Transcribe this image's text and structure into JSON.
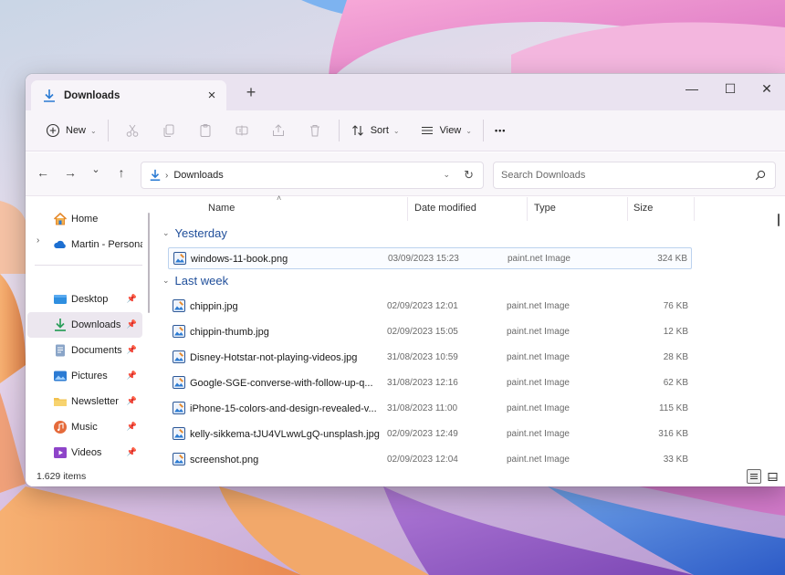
{
  "window": {
    "tab_title": "Downloads",
    "tab_close": "×",
    "new_tab": "+",
    "minimize": "—",
    "maximize": "☐",
    "close": "✕"
  },
  "toolbar": {
    "new_label": "New",
    "sort_label": "Sort",
    "view_label": "View",
    "more_label": "•••",
    "icons": [
      "cut-icon",
      "copy-icon",
      "paste-icon",
      "rename-icon",
      "share-icon",
      "delete-icon"
    ]
  },
  "address": {
    "back": "←",
    "forward": "→",
    "recent": "⌄",
    "up": "↑",
    "separator": "›",
    "crumb": "Downloads",
    "dropdown": "⌄",
    "refresh": "↻"
  },
  "search": {
    "placeholder": "Search Downloads"
  },
  "sidebar": {
    "expand_chevron": "›",
    "items": [
      {
        "label": "Home",
        "icon": "home-icon",
        "pinned": false
      },
      {
        "label": "Martin - Personal",
        "icon": "onedrive-icon",
        "pinned": false
      },
      {
        "label": "Desktop",
        "icon": "desktop-icon",
        "pinned": true
      },
      {
        "label": "Downloads",
        "icon": "download-icon",
        "pinned": true,
        "active": true
      },
      {
        "label": "Documents",
        "icon": "documents-icon",
        "pinned": true
      },
      {
        "label": "Pictures",
        "icon": "pictures-icon",
        "pinned": true
      },
      {
        "label": "Newsletter",
        "icon": "folder-icon",
        "pinned": true
      },
      {
        "label": "Music",
        "icon": "music-icon",
        "pinned": true
      },
      {
        "label": "Videos",
        "icon": "videos-icon",
        "pinned": true
      }
    ]
  },
  "columns": {
    "name": "Name",
    "date": "Date modified",
    "type": "Type",
    "size": "Size"
  },
  "groups": [
    {
      "label": "Yesterday",
      "files": [
        {
          "name": "windows-11-book.png",
          "date": "03/09/2023 15:23",
          "type": "paint.net Image",
          "size": "324 KB",
          "selected": true
        }
      ]
    },
    {
      "label": "Last week",
      "files": [
        {
          "name": "chippin.jpg",
          "date": "02/09/2023 12:01",
          "type": "paint.net Image",
          "size": "76 KB"
        },
        {
          "name": "chippin-thumb.jpg",
          "date": "02/09/2023 15:05",
          "type": "paint.net Image",
          "size": "12 KB"
        },
        {
          "name": "Disney-Hotstar-not-playing-videos.jpg",
          "date": "31/08/2023 10:59",
          "type": "paint.net Image",
          "size": "28 KB"
        },
        {
          "name": "Google-SGE-converse-with-follow-up-q...",
          "date": "31/08/2023 12:16",
          "type": "paint.net Image",
          "size": "62 KB"
        },
        {
          "name": "iPhone-15-colors-and-design-revealed-v...",
          "date": "31/08/2023 11:00",
          "type": "paint.net Image",
          "size": "115 KB"
        },
        {
          "name": "kelly-sikkema-tJU4VLwwLgQ-unsplash.jpg",
          "date": "02/09/2023 12:49",
          "type": "paint.net Image",
          "size": "316 KB"
        },
        {
          "name": "screenshot.png",
          "date": "02/09/2023 12:04",
          "type": "paint.net Image",
          "size": "33 KB"
        }
      ]
    }
  ],
  "status": {
    "count": "1.629 items"
  },
  "colors": {
    "accent": "#2b7bd3",
    "group_heading": "#1f4e9a",
    "titlebar": "#eae3f0",
    "active_item": "#ece7ef"
  }
}
